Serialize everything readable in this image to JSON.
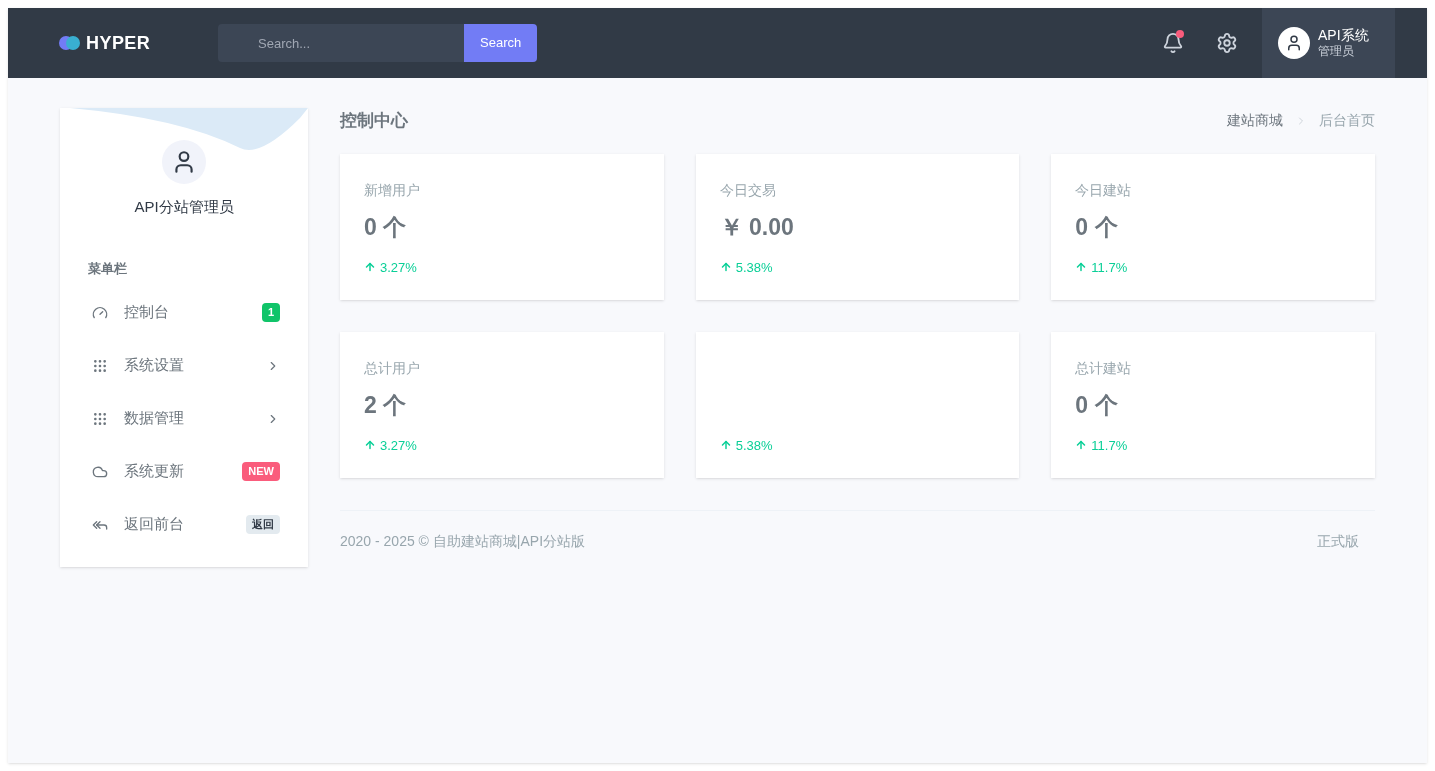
{
  "topbar": {
    "logo": "HYPER",
    "search": {
      "placeholder": "Search...",
      "button": "Search"
    },
    "notification_dot": true,
    "user": {
      "name": "API系统",
      "role": "管理员"
    }
  },
  "sidebar": {
    "profile_name": "API分站管理员",
    "section_title": "菜单栏",
    "items": [
      {
        "label": "控制台",
        "kind": "badge",
        "badge": "1",
        "color": "#10c469"
      },
      {
        "label": "系统设置",
        "kind": "chevron"
      },
      {
        "label": "数据管理",
        "kind": "chevron"
      },
      {
        "label": "系统更新",
        "kind": "badge",
        "badge": "NEW",
        "color": "#fa5c7c"
      },
      {
        "label": "返回前台",
        "kind": "badge",
        "badge": "返回",
        "color": "#e3eaef"
      }
    ]
  },
  "page": {
    "title": "控制中心",
    "breadcrumb": [
      {
        "label": "建站商城",
        "selected": false
      },
      {
        "label": "后台首页",
        "selected": true
      }
    ]
  },
  "stats": [
    {
      "title": "新增用户",
      "value": "0 个",
      "trend": "3.27%"
    },
    {
      "title": "今日交易",
      "value": "￥ 0.00",
      "trend": "5.38%"
    },
    {
      "title": "今日建站",
      "value": "0 个",
      "trend": "11.7%"
    },
    {
      "title": "总计用户",
      "value": "2 个",
      "trend": "3.27%"
    },
    {
      "trend": "5.38%"
    },
    {
      "title": "总计建站",
      "value": "0 个",
      "trend": "11.7%"
    }
  ],
  "footer": {
    "copyright": "2020 - 2025 © 自助建站商城|API分站版",
    "version": "正式版"
  }
}
